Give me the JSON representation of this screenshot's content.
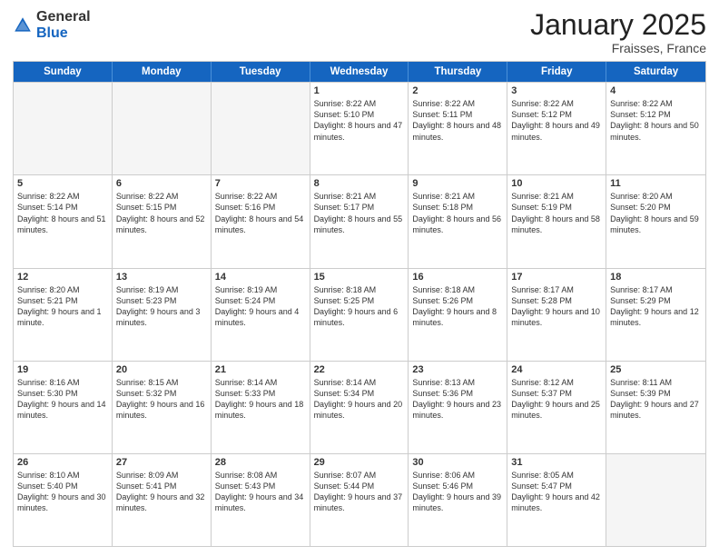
{
  "logo": {
    "general": "General",
    "blue": "Blue"
  },
  "header": {
    "month": "January 2025",
    "location": "Fraisses, France"
  },
  "weekdays": [
    "Sunday",
    "Monday",
    "Tuesday",
    "Wednesday",
    "Thursday",
    "Friday",
    "Saturday"
  ],
  "weeks": [
    [
      {
        "day": "",
        "text": ""
      },
      {
        "day": "",
        "text": ""
      },
      {
        "day": "",
        "text": ""
      },
      {
        "day": "1",
        "text": "Sunrise: 8:22 AM\nSunset: 5:10 PM\nDaylight: 8 hours and 47 minutes."
      },
      {
        "day": "2",
        "text": "Sunrise: 8:22 AM\nSunset: 5:11 PM\nDaylight: 8 hours and 48 minutes."
      },
      {
        "day": "3",
        "text": "Sunrise: 8:22 AM\nSunset: 5:12 PM\nDaylight: 8 hours and 49 minutes."
      },
      {
        "day": "4",
        "text": "Sunrise: 8:22 AM\nSunset: 5:12 PM\nDaylight: 8 hours and 50 minutes."
      }
    ],
    [
      {
        "day": "5",
        "text": "Sunrise: 8:22 AM\nSunset: 5:14 PM\nDaylight: 8 hours and 51 minutes."
      },
      {
        "day": "6",
        "text": "Sunrise: 8:22 AM\nSunset: 5:15 PM\nDaylight: 8 hours and 52 minutes."
      },
      {
        "day": "7",
        "text": "Sunrise: 8:22 AM\nSunset: 5:16 PM\nDaylight: 8 hours and 54 minutes."
      },
      {
        "day": "8",
        "text": "Sunrise: 8:21 AM\nSunset: 5:17 PM\nDaylight: 8 hours and 55 minutes."
      },
      {
        "day": "9",
        "text": "Sunrise: 8:21 AM\nSunset: 5:18 PM\nDaylight: 8 hours and 56 minutes."
      },
      {
        "day": "10",
        "text": "Sunrise: 8:21 AM\nSunset: 5:19 PM\nDaylight: 8 hours and 58 minutes."
      },
      {
        "day": "11",
        "text": "Sunrise: 8:20 AM\nSunset: 5:20 PM\nDaylight: 8 hours and 59 minutes."
      }
    ],
    [
      {
        "day": "12",
        "text": "Sunrise: 8:20 AM\nSunset: 5:21 PM\nDaylight: 9 hours and 1 minute."
      },
      {
        "day": "13",
        "text": "Sunrise: 8:19 AM\nSunset: 5:23 PM\nDaylight: 9 hours and 3 minutes."
      },
      {
        "day": "14",
        "text": "Sunrise: 8:19 AM\nSunset: 5:24 PM\nDaylight: 9 hours and 4 minutes."
      },
      {
        "day": "15",
        "text": "Sunrise: 8:18 AM\nSunset: 5:25 PM\nDaylight: 9 hours and 6 minutes."
      },
      {
        "day": "16",
        "text": "Sunrise: 8:18 AM\nSunset: 5:26 PM\nDaylight: 9 hours and 8 minutes."
      },
      {
        "day": "17",
        "text": "Sunrise: 8:17 AM\nSunset: 5:28 PM\nDaylight: 9 hours and 10 minutes."
      },
      {
        "day": "18",
        "text": "Sunrise: 8:17 AM\nSunset: 5:29 PM\nDaylight: 9 hours and 12 minutes."
      }
    ],
    [
      {
        "day": "19",
        "text": "Sunrise: 8:16 AM\nSunset: 5:30 PM\nDaylight: 9 hours and 14 minutes."
      },
      {
        "day": "20",
        "text": "Sunrise: 8:15 AM\nSunset: 5:32 PM\nDaylight: 9 hours and 16 minutes."
      },
      {
        "day": "21",
        "text": "Sunrise: 8:14 AM\nSunset: 5:33 PM\nDaylight: 9 hours and 18 minutes."
      },
      {
        "day": "22",
        "text": "Sunrise: 8:14 AM\nSunset: 5:34 PM\nDaylight: 9 hours and 20 minutes."
      },
      {
        "day": "23",
        "text": "Sunrise: 8:13 AM\nSunset: 5:36 PM\nDaylight: 9 hours and 23 minutes."
      },
      {
        "day": "24",
        "text": "Sunrise: 8:12 AM\nSunset: 5:37 PM\nDaylight: 9 hours and 25 minutes."
      },
      {
        "day": "25",
        "text": "Sunrise: 8:11 AM\nSunset: 5:39 PM\nDaylight: 9 hours and 27 minutes."
      }
    ],
    [
      {
        "day": "26",
        "text": "Sunrise: 8:10 AM\nSunset: 5:40 PM\nDaylight: 9 hours and 30 minutes."
      },
      {
        "day": "27",
        "text": "Sunrise: 8:09 AM\nSunset: 5:41 PM\nDaylight: 9 hours and 32 minutes."
      },
      {
        "day": "28",
        "text": "Sunrise: 8:08 AM\nSunset: 5:43 PM\nDaylight: 9 hours and 34 minutes."
      },
      {
        "day": "29",
        "text": "Sunrise: 8:07 AM\nSunset: 5:44 PM\nDaylight: 9 hours and 37 minutes."
      },
      {
        "day": "30",
        "text": "Sunrise: 8:06 AM\nSunset: 5:46 PM\nDaylight: 9 hours and 39 minutes."
      },
      {
        "day": "31",
        "text": "Sunrise: 8:05 AM\nSunset: 5:47 PM\nDaylight: 9 hours and 42 minutes."
      },
      {
        "day": "",
        "text": ""
      }
    ]
  ]
}
